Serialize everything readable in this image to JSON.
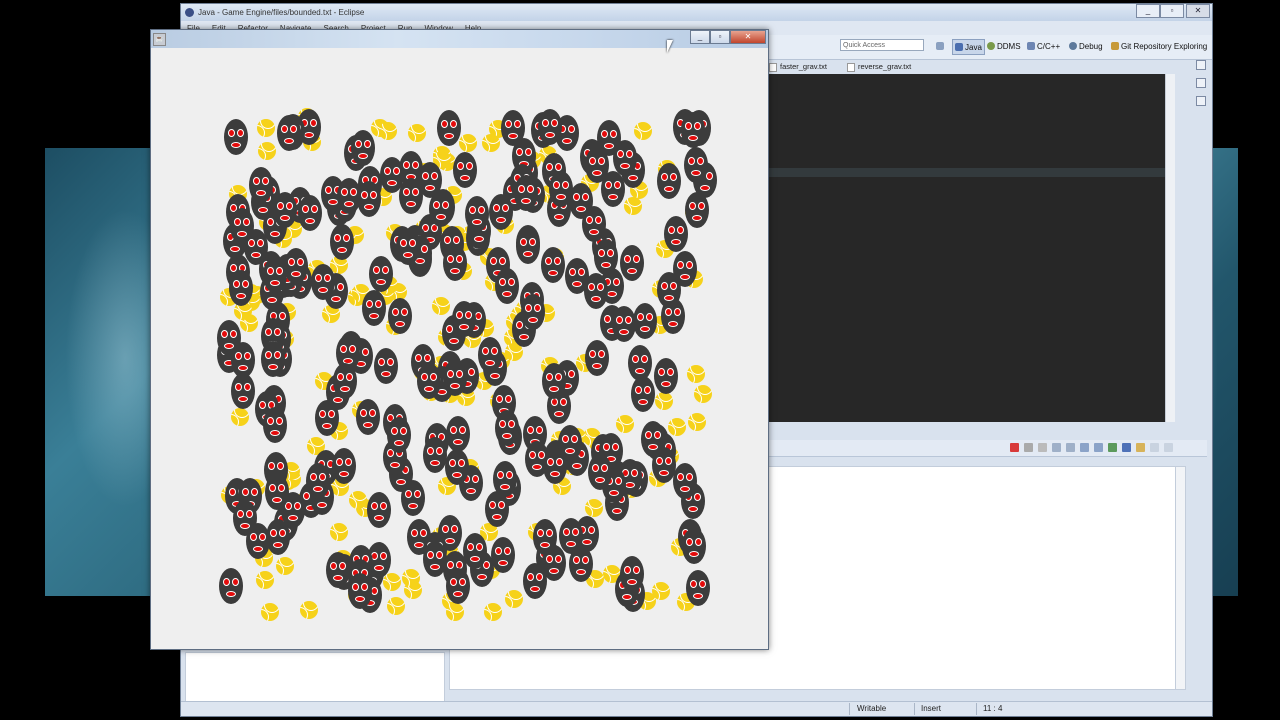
{
  "eclipse": {
    "title": "Java - Game Engine/files/bounded.txt - Eclipse",
    "menu": [
      "File",
      "Edit",
      "Refactor",
      "Navigate",
      "Search",
      "Project",
      "Run",
      "Window",
      "Help"
    ],
    "quick_access_placeholder": "Quick Access",
    "perspectives": [
      "Java",
      "DDMS",
      "C/C++",
      "Debug",
      "Git Repository Exploring"
    ],
    "editor_tabs": [
      "faster_grav.txt",
      "reverse_grav.txt"
    ],
    "status": {
      "writable": "Writable",
      "insert": "Insert",
      "position": "11 : 4"
    }
  },
  "game_window": {
    "sprite_counts": {
      "faces": 230,
      "balls": 160
    },
    "colors": {
      "face": "#3c3c3c",
      "eye": "#e40b0b",
      "ball": "#f6d21a",
      "canvas": "#efefef"
    }
  }
}
